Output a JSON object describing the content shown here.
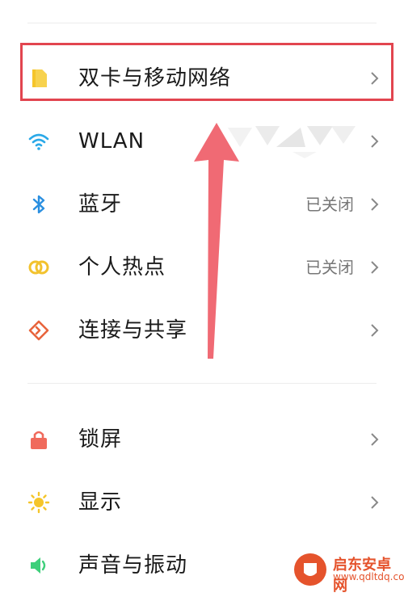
{
  "settings": {
    "group1": [
      {
        "id": "dual-sim",
        "label": "双卡与移动网络",
        "value": "",
        "icon": "sim-card-icon"
      },
      {
        "id": "wlan",
        "label": "WLAN",
        "value": "",
        "icon": "wifi-icon"
      },
      {
        "id": "bluetooth",
        "label": "蓝牙",
        "value": "已关闭",
        "icon": "bluetooth-icon"
      },
      {
        "id": "hotspot",
        "label": "个人热点",
        "value": "已关闭",
        "icon": "hotspot-icon"
      },
      {
        "id": "connection",
        "label": "连接与共享",
        "value": "",
        "icon": "share-icon"
      }
    ],
    "group2": [
      {
        "id": "lockscreen",
        "label": "锁屏",
        "value": "",
        "icon": "lock-icon"
      },
      {
        "id": "display",
        "label": "显示",
        "value": "",
        "icon": "sun-icon"
      },
      {
        "id": "sound",
        "label": "声音与振动",
        "value": "",
        "icon": "speaker-icon"
      }
    ]
  },
  "colors": {
    "highlight": "#e2454f",
    "sim": "#f5c52a",
    "wifi": "#2aa9e8",
    "bluetooth": "#2a8fe0",
    "hotspot": "#f2c22e",
    "share": "#e8643c",
    "lock": "#f06a5c",
    "sun": "#f5c52a",
    "speaker": "#3ecf7a"
  },
  "watermark": {
    "title": "启东安卓网",
    "url": "www.qdltdq.com"
  }
}
